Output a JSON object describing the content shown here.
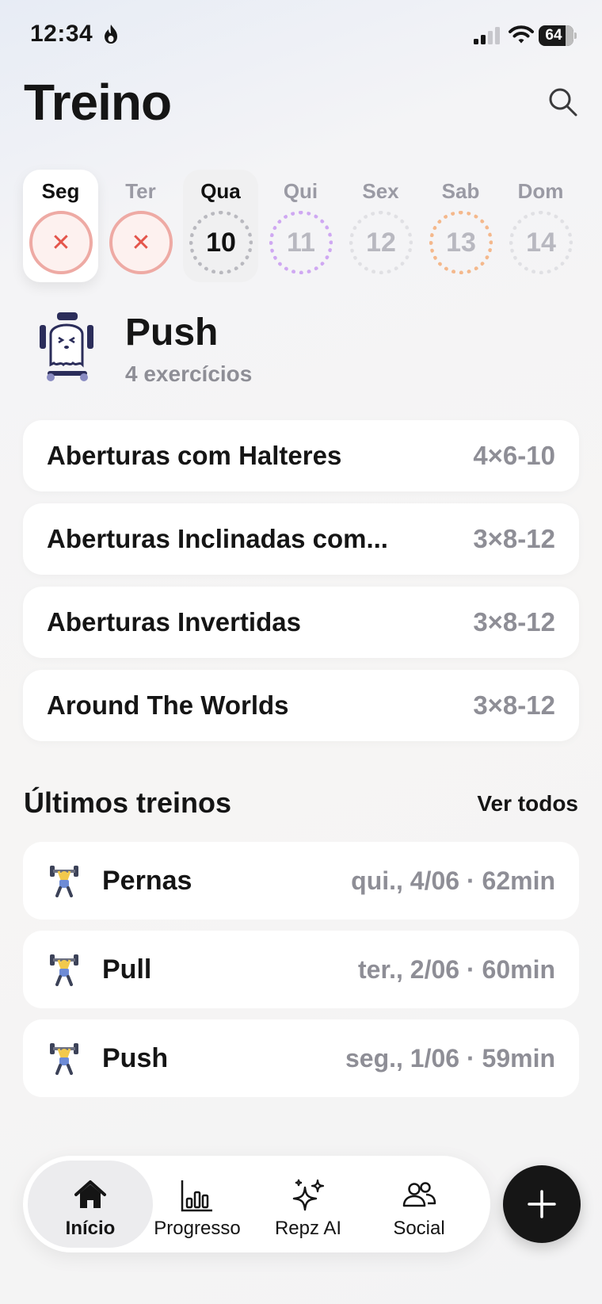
{
  "status_bar": {
    "time": "12:34",
    "battery": "64"
  },
  "header": {
    "title": "Treino"
  },
  "week": [
    {
      "label": "Seg",
      "value": "✕",
      "state": "missed",
      "selected": "white"
    },
    {
      "label": "Ter",
      "value": "✕",
      "state": "missed",
      "selected": ""
    },
    {
      "label": "Qua",
      "value": "10",
      "state": "today",
      "selected": "grey"
    },
    {
      "label": "Qui",
      "value": "11",
      "state": "planned-purple",
      "selected": ""
    },
    {
      "label": "Sex",
      "value": "12",
      "state": "rest",
      "selected": ""
    },
    {
      "label": "Sab",
      "value": "13",
      "state": "planned-orange",
      "selected": ""
    },
    {
      "label": "Dom",
      "value": "14",
      "state": "rest",
      "selected": ""
    }
  ],
  "workout": {
    "name": "Push",
    "count": "4 exercícios",
    "exercises": [
      {
        "name": "Aberturas com Halteres",
        "sets": "4×6-10"
      },
      {
        "name": "Aberturas Inclinadas com...",
        "sets": "3×8-12"
      },
      {
        "name": "Aberturas Invertidas",
        "sets": "3×8-12"
      },
      {
        "name": "Around The Worlds",
        "sets": "3×8-12"
      }
    ]
  },
  "history": {
    "title": "Últimos treinos",
    "see_all": "Ver todos",
    "items": [
      {
        "name": "Pernas",
        "meta": "qui., 4/06 · 62min",
        "icon": "weightlifter-icon"
      },
      {
        "name": "Pull",
        "meta": "ter., 2/06 · 60min",
        "icon": "weightlifter-icon"
      },
      {
        "name": "Push",
        "meta": "seg., 1/06 · 59min",
        "icon": "weightlifter-icon"
      }
    ]
  },
  "tabbar": {
    "tabs": [
      {
        "label": "Início",
        "icon": "home-icon",
        "active": true
      },
      {
        "label": "Progresso",
        "icon": "bar-chart-icon",
        "active": false
      },
      {
        "label": "Repz AI",
        "icon": "sparkles-icon",
        "active": false
      },
      {
        "label": "Social",
        "icon": "people-icon",
        "active": false
      }
    ],
    "fab_icon": "plus-icon"
  },
  "colors": {
    "missed": "#e4554b",
    "purple": "#cfa8f2",
    "orange": "#f4b88c",
    "fab": "#161616"
  }
}
